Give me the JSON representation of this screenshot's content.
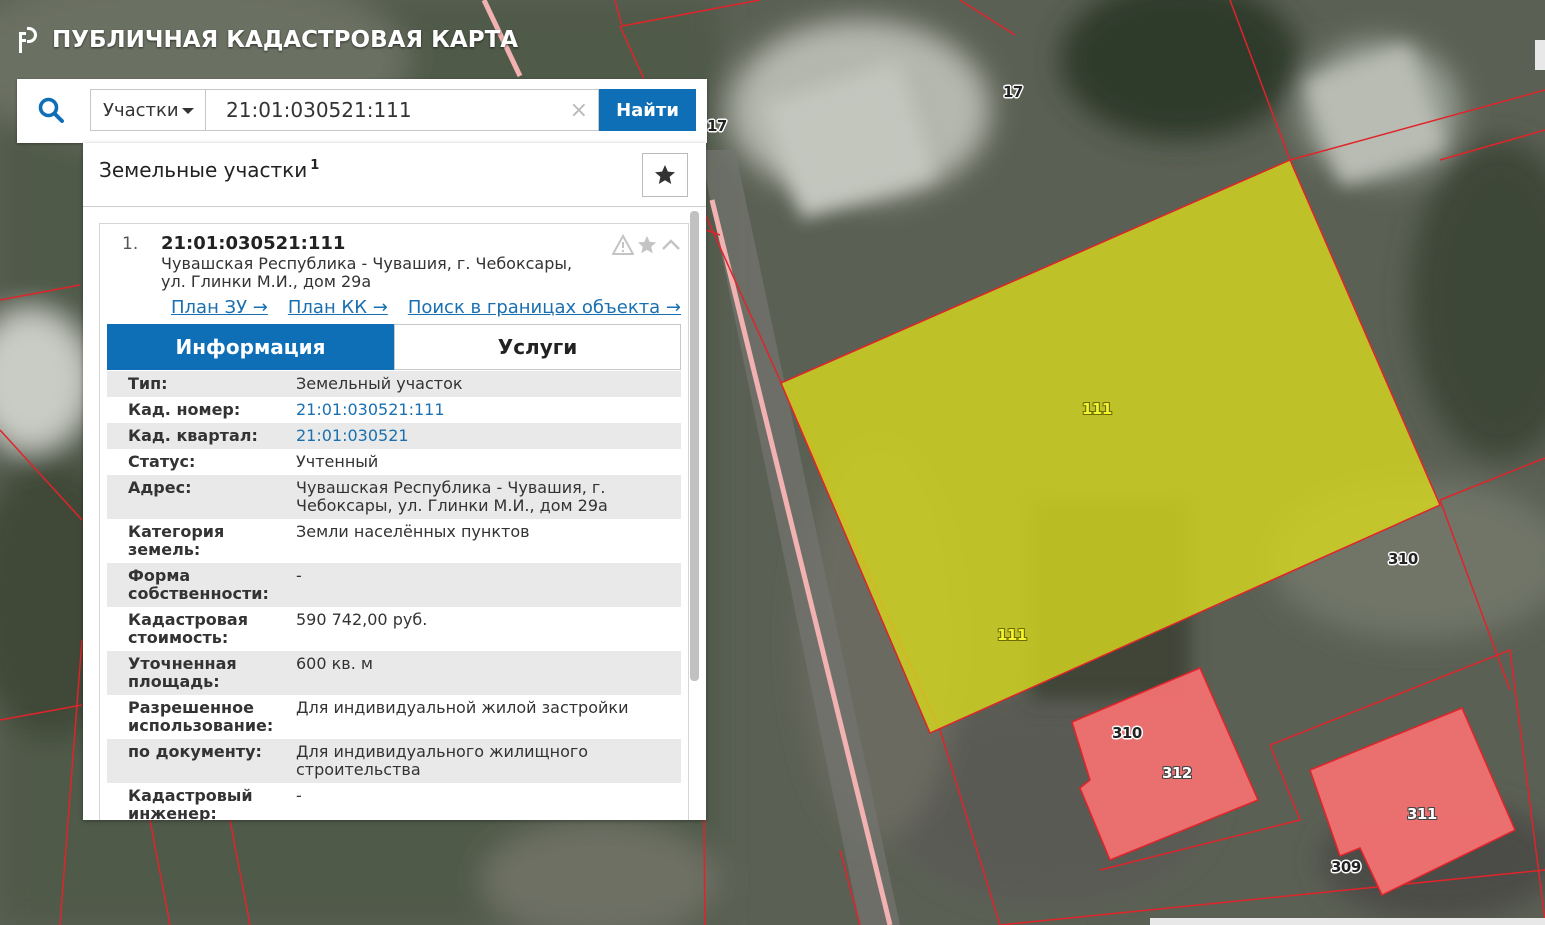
{
  "app": {
    "title": "ПУБЛИЧНАЯ КАДАСТРОВАЯ КАРТА"
  },
  "search": {
    "type_selected": "Участки",
    "query": "21:01:030521:111",
    "clear_symbol": "×",
    "find_label": "Найти"
  },
  "panel": {
    "title": "Земельные участки",
    "count": "1"
  },
  "result": {
    "index": "1.",
    "cad_number": "21:01:030521:111",
    "address": "Чувашская Республика - Чувашия, г. Чебоксары, ул. Глинки М.И., дом 29а",
    "links": [
      "План ЗУ →",
      "План КК →",
      "Поиск в границах объекта →"
    ],
    "tabs": {
      "info": "Информация",
      "services": "Услуги"
    },
    "rows": [
      {
        "label": "Тип:",
        "value": "Земельный участок"
      },
      {
        "label": "Кад. номер:",
        "value": "21:01:030521:111"
      },
      {
        "label": "Кад. квартал:",
        "value": "21:01:030521"
      },
      {
        "label": "Статус:",
        "value": "Учтенный"
      },
      {
        "label": "Адрес:",
        "value": "Чувашская Республика - Чувашия, г. Чебоксары, ул. Глинки М.И., дом 29а"
      },
      {
        "label": "Категория земель:",
        "value": "Земли населённых пунктов"
      },
      {
        "label": "Форма собственности:",
        "value": "-"
      },
      {
        "label": "Кадастровая стоимость:",
        "value": "590 742,00 руб."
      },
      {
        "label": "Уточненная площадь:",
        "value": "600 кв. м"
      },
      {
        "label": "Разрешенное использование:",
        "value": "Для индивидуальной жилой застройки"
      },
      {
        "label": "по документу:",
        "value": "Для индивидуального жилищного строительства"
      },
      {
        "label": "Кадастровый инженер:",
        "value": "-"
      }
    ]
  },
  "map": {
    "labels": [
      "17",
      "17",
      "111",
      "111",
      "310",
      "310",
      "312",
      "311",
      "309"
    ]
  },
  "colors": {
    "accent": "#0e6fb7",
    "link": "#1a6fb0",
    "parcel_highlight": "#d4d71f",
    "building_fill": "#f27171",
    "boundary": "#e0242a"
  },
  "icons": {
    "search": "magnifier",
    "favorite": "star",
    "warning": "triangle-exclamation",
    "collapse": "chevron-up"
  }
}
